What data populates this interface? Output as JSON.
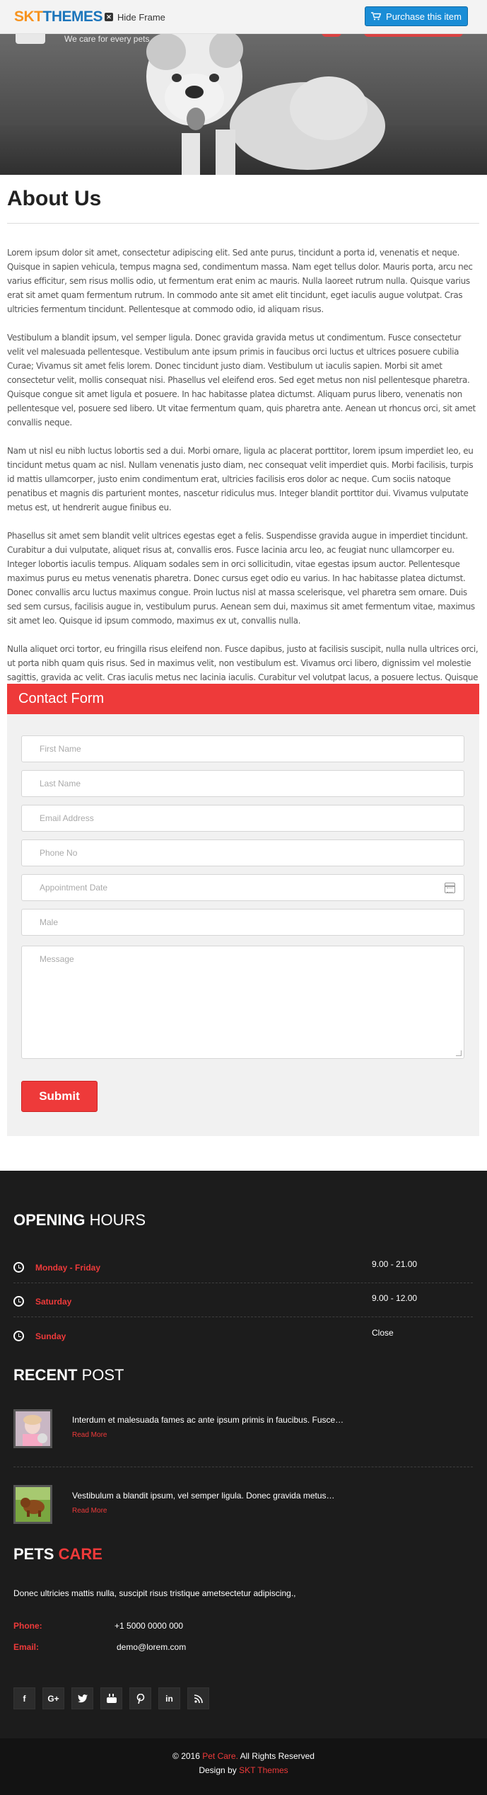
{
  "topbar": {
    "logo_part1": "SKT",
    "logo_part2": "THEMES",
    "hide_frame": "Hide Frame",
    "purchase": "Purchase this item"
  },
  "hero": {
    "tagline": "We care for every pets"
  },
  "about": {
    "title": "About Us",
    "paragraphs": [
      "Lorem ipsum dolor sit amet, consectetur adipiscing elit. Sed ante purus, tincidunt a porta id, venenatis et neque. Quisque in sapien vehicula, tempus magna sed, condimentum massa. Nam eget tellus dolor. Mauris porta, arcu nec varius efficitur, sem risus mollis odio, ut fermentum erat enim ac mauris. Nulla laoreet rutrum nulla. Quisque varius erat sit amet quam fermentum rutrum. In commodo ante sit amet elit tincidunt, eget iaculis augue volutpat. Cras ultricies fermentum tincidunt. Pellentesque at commodo odio, id aliquam risus.",
      "Vestibulum a blandit ipsum, vel semper ligula. Donec gravida gravida metus ut condimentum. Fusce consectetur velit vel malesuada pellentesque. Vestibulum ante ipsum primis in faucibus orci luctus et ultrices posuere cubilia Curae; Vivamus sit amet felis lorem. Donec tincidunt justo diam. Vestibulum ut iaculis sapien. Morbi sit amet consectetur velit, mollis consequat nisi. Phasellus vel eleifend eros. Sed eget metus non nisl pellentesque pharetra. Quisque congue sit amet ligula et posuere. In hac habitasse platea dictumst. Aliquam purus libero, venenatis non pellentesque vel, posuere sed libero. Ut vitae fermentum quam, quis pharetra ante. Aenean ut rhoncus orci, sit amet convallis neque.",
      "Nam ut nisl eu nibh luctus lobortis sed a dui. Morbi ornare, ligula ac placerat porttitor, lorem ipsum imperdiet leo, eu tincidunt metus quam ac nisl. Nullam venenatis justo diam, nec consequat velit imperdiet quis. Morbi facilisis, turpis id mattis ullamcorper, justo enim condimentum erat, ultricies facilisis eros dolor ac neque. Cum sociis natoque penatibus et magnis dis parturient montes, nascetur ridiculus mus. Integer blandit porttitor dui. Vivamus vulputate metus est, ut hendrerit augue finibus eu.",
      "Phasellus sit amet sem blandit velit ultrices egestas eget a felis. Suspendisse gravida augue in imperdiet tincidunt. Curabitur a dui vulputate, aliquet risus at, convallis eros. Fusce lacinia arcu leo, ac feugiat nunc ullamcorper eu. Integer lobortis iaculis tempus. Aliquam sodales sem in orci sollicitudin, vitae egestas ipsum auctor. Pellentesque maximus purus eu metus venenatis pharetra. Donec cursus eget odio eu varius. In hac habitasse platea dictumst. Donec convallis arcu luctus maximus congue. Proin luctus nisl at massa scelerisque, vel pharetra sem ornare. Duis sed sem cursus, facilisis augue in, vestibulum purus. Aenean sem dui, maximus sit amet fermentum vitae, maximus sit amet leo. Quisque id ipsum commodo, maximus ex ut, convallis nulla.",
      "Nulla aliquet orci tortor, eu fringilla risus eleifend non. Fusce dapibus, justo at facilisis suscipit, nulla nulla ultrices orci, ut porta nibh quam quis risus. Sed in maximus velit, non vestibulum est. Vivamus orci libero, dignissim vel molestie sagittis, gravida ac velit. Cras iaculis metus nec lacinia iaculis. Curabitur vel volutpat lacus, a posuere lectus. Quisque viverra placerat tempus. Integer ac pulvinar orci. Nulla eleifend est odio, ac tempor metus fermentum at. Nunc vel eros pellentesque, efficitur lorem in, pretium dolor."
    ]
  },
  "contact_form": {
    "title": "Contact Form",
    "first_name": "First Name",
    "last_name": "Last Name",
    "email": "Email Address",
    "phone": "Phone No",
    "date": "Appointment Date",
    "gender": "Male",
    "message": "Message",
    "submit": "Submit"
  },
  "opening_hours": {
    "title_bold": "OPENING",
    "title_light": "HOURS",
    "rows": [
      {
        "day": "Monday - Friday",
        "time": "9.00 - 21.00"
      },
      {
        "day": "Saturday",
        "time": "9.00 - 12.00"
      },
      {
        "day": "Sunday",
        "time": "Close"
      }
    ]
  },
  "recent_post": {
    "title_bold": "RECENT",
    "title_light": "POST",
    "posts": [
      {
        "text": "Interdum et malesuada fames ac ante ipsum primis in faucibus. Fusce…",
        "more": "Read More"
      },
      {
        "text": "Vestibulum a blandit ipsum, vel semper ligula. Donec gravida metus…",
        "more": "Read More"
      }
    ]
  },
  "pets_care": {
    "title_white": "PETS",
    "title_red": "CARE",
    "desc": "Donec ultricies mattis nulla, suscipit risus tristique ametsectetur adipiscing.,",
    "phone_label": "Phone:",
    "phone": "+1 5000 0000 000",
    "email_label": "Email:",
    "email": "demo@lorem.com"
  },
  "social": [
    "f",
    "G+",
    "t",
    "yt",
    "p",
    "in",
    "rss"
  ],
  "footer": {
    "copy_prefix": "© 2016",
    "brand": "Pet Care.",
    "rights": "All Rights Reserved",
    "design_by": "Design by",
    "designer": "SKT Themes"
  },
  "colors": {
    "accent": "#ee3a3a",
    "footer_bg": "#1c1c1c",
    "purchase_blue": "#1a8dd6"
  }
}
